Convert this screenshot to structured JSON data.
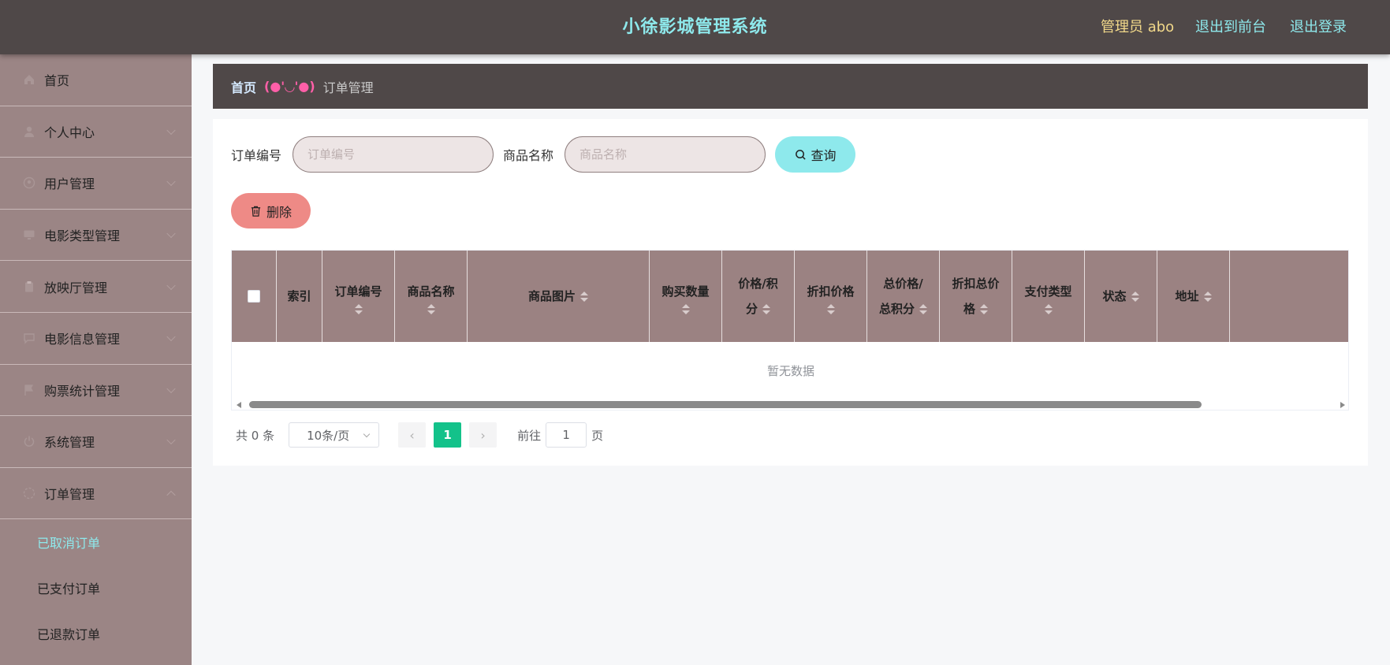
{
  "header": {
    "title": "小徐影城管理系统",
    "admin": "管理员 abo",
    "to_front": "退出到前台",
    "logout": "退出登录"
  },
  "sidebar": {
    "items": [
      {
        "label": "首页",
        "icon": "home-icon",
        "has_arrow": false
      },
      {
        "label": "个人中心",
        "icon": "user-icon",
        "has_arrow": true
      },
      {
        "label": "用户管理",
        "icon": "users-icon",
        "has_arrow": true
      },
      {
        "label": "电影类型管理",
        "icon": "monitor-icon",
        "has_arrow": true
      },
      {
        "label": "放映厅管理",
        "icon": "clipboard-icon",
        "has_arrow": true
      },
      {
        "label": "电影信息管理",
        "icon": "message-icon",
        "has_arrow": true
      },
      {
        "label": "购票统计管理",
        "icon": "flag-icon",
        "has_arrow": true
      },
      {
        "label": "系统管理",
        "icon": "power-icon",
        "has_arrow": true
      },
      {
        "label": "订单管理",
        "icon": "order-icon",
        "has_arrow": true,
        "expanded": true
      }
    ],
    "subitems": [
      {
        "label": "已取消订单",
        "active": true
      },
      {
        "label": "已支付订单",
        "active": false
      },
      {
        "label": "已退款订单",
        "active": false
      }
    ]
  },
  "breadcrumb": {
    "home": "首页",
    "separator": "(●'◡'●)",
    "current": "订单管理"
  },
  "search": {
    "order_no_label": "订单编号",
    "order_no_placeholder": "订单编号",
    "product_label": "商品名称",
    "product_placeholder": "商品名称",
    "query_label": "查询"
  },
  "actions": {
    "delete_label": "删除"
  },
  "table": {
    "columns": [
      {
        "line1": "索引",
        "line2": "",
        "sortable": false
      },
      {
        "line1": "订单编号",
        "line2": "",
        "sortable": true
      },
      {
        "line1": "商品名称",
        "line2": "",
        "sortable": true
      },
      {
        "line1": "商品图片",
        "line2": "",
        "sortable": true
      },
      {
        "line1": "购买数量",
        "line2": "",
        "sortable": true
      },
      {
        "line1": "价格/积",
        "line2": "分",
        "sortable": true
      },
      {
        "line1": "折扣价格",
        "line2": "",
        "sortable": true
      },
      {
        "line1": "总价格/",
        "line2": "总积分",
        "sortable": true
      },
      {
        "line1": "折扣总价",
        "line2": "格",
        "sortable": true
      },
      {
        "line1": "支付类型",
        "line2": "",
        "sortable": true
      },
      {
        "line1": "状态",
        "line2": "",
        "sortable": true
      },
      {
        "line1": "地址",
        "line2": "",
        "sortable": true
      }
    ],
    "empty_text": "暂无数据"
  },
  "pagination": {
    "total": "共 0 条",
    "page_size": "10条/页",
    "current_page": "1",
    "goto_label": "前往",
    "goto_value": "1",
    "page_suffix": "页"
  },
  "colors": {
    "header_bg": "#4f4848",
    "sidebar_bg": "#9b8585",
    "accent_cyan": "#8ee9ec",
    "delete_red": "#ee8a86",
    "page_active": "#13c28a"
  }
}
